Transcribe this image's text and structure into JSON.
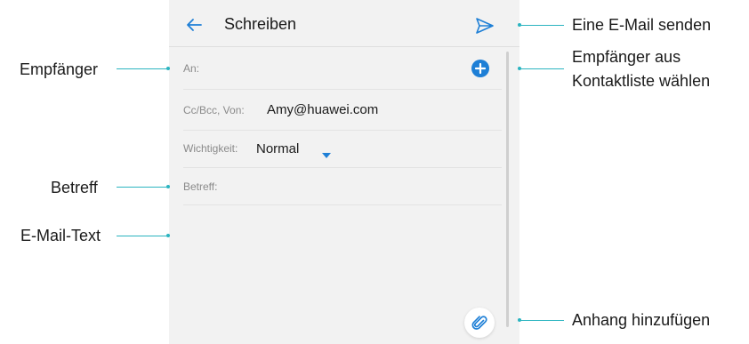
{
  "screen": {
    "title": "Schreiben",
    "to_label": "An:",
    "cc_label": "Cc/Bcc, Von:",
    "cc_value": "Amy@huawei.com",
    "priority_label": "Wichtigkeit:",
    "priority_value": "Normal",
    "subject_label": "Betreff:",
    "icons": {
      "back": "arrow-left-icon",
      "send": "send-icon",
      "add_contact": "plus-circle-icon",
      "priority_dropdown": "caret-down-icon",
      "attach": "paperclip-icon"
    },
    "colors": {
      "accent": "#1e7fd6",
      "leader": "#2bb4c0",
      "screen_bg": "#f2f2f2"
    }
  },
  "callouts": {
    "send": "Eine E-Mail senden",
    "contacts_line1": "Empfänger aus",
    "contacts_line2": "Kontaktliste wählen",
    "recipient": "Empfänger",
    "subject": "Betreff",
    "body": "E-Mail-Text",
    "attach": "Anhang hinzufügen"
  }
}
